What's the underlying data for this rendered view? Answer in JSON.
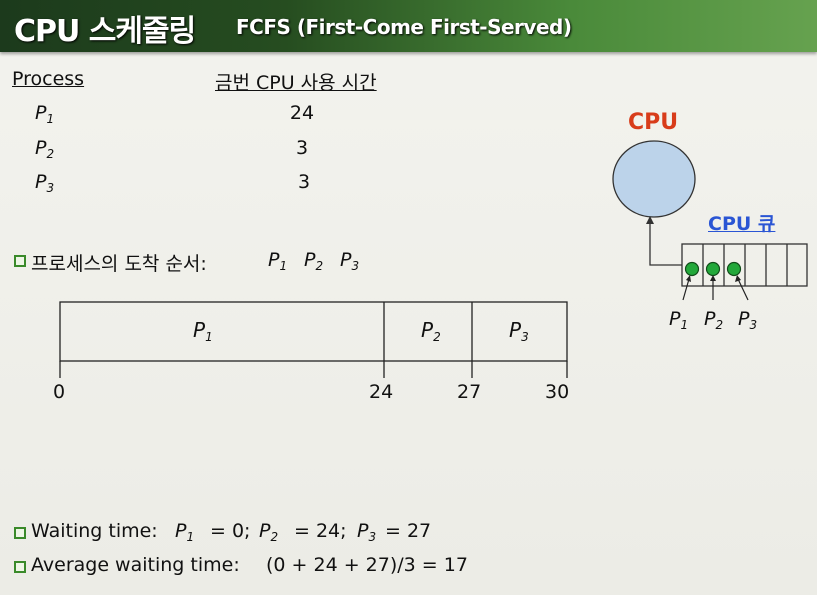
{
  "title": {
    "main": "CPU 스케줄링",
    "sub": "FCFS (First-Come First-Served)"
  },
  "table": {
    "headers": [
      "Process",
      "금번 CPU 사용 시간"
    ],
    "rows": [
      {
        "process": "P",
        "sub": "1",
        "burst": "24"
      },
      {
        "process": "P",
        "sub": "2",
        "burst": "3"
      },
      {
        "process": "P",
        "sub": "3",
        "burst": "3"
      }
    ]
  },
  "arrival": {
    "label": "프로세스의 도착 순서:",
    "order": [
      {
        "p": "P",
        "sub": "1"
      },
      {
        "p": "P",
        "sub": "2"
      },
      {
        "p": "P",
        "sub": "3"
      }
    ]
  },
  "gantt": {
    "bars": [
      {
        "p": "P",
        "sub": "1",
        "start": 0,
        "end": 24
      },
      {
        "p": "P",
        "sub": "2",
        "start": 24,
        "end": 27
      },
      {
        "p": "P",
        "sub": "3",
        "start": 27,
        "end": 30
      }
    ],
    "ticks": [
      "0",
      "24",
      "27",
      "30"
    ]
  },
  "cpu_diagram": {
    "cpu_label": "CPU",
    "queue_label": "CPU 큐",
    "queue_processes": [
      {
        "p": "P",
        "sub": "1"
      },
      {
        "p": "P",
        "sub": "2"
      },
      {
        "p": "P",
        "sub": "3"
      }
    ],
    "colors": {
      "cpu_label": "#d83c1a",
      "queue_label": "#2a55d4",
      "cpu_fill": "#bcd3ea",
      "process_dot": "#22a83a"
    }
  },
  "waiting": {
    "label": "Waiting time:",
    "items": [
      {
        "p": "P",
        "sub": "1",
        "value": "= 0;"
      },
      {
        "p": "P",
        "sub": "2",
        "value": "= 24;"
      },
      {
        "p": "P",
        "sub": "3",
        "value": "= 27"
      }
    ]
  },
  "average": {
    "label": "Average waiting time:",
    "formula": "(0 + 24 + 27)/3 = 17"
  }
}
